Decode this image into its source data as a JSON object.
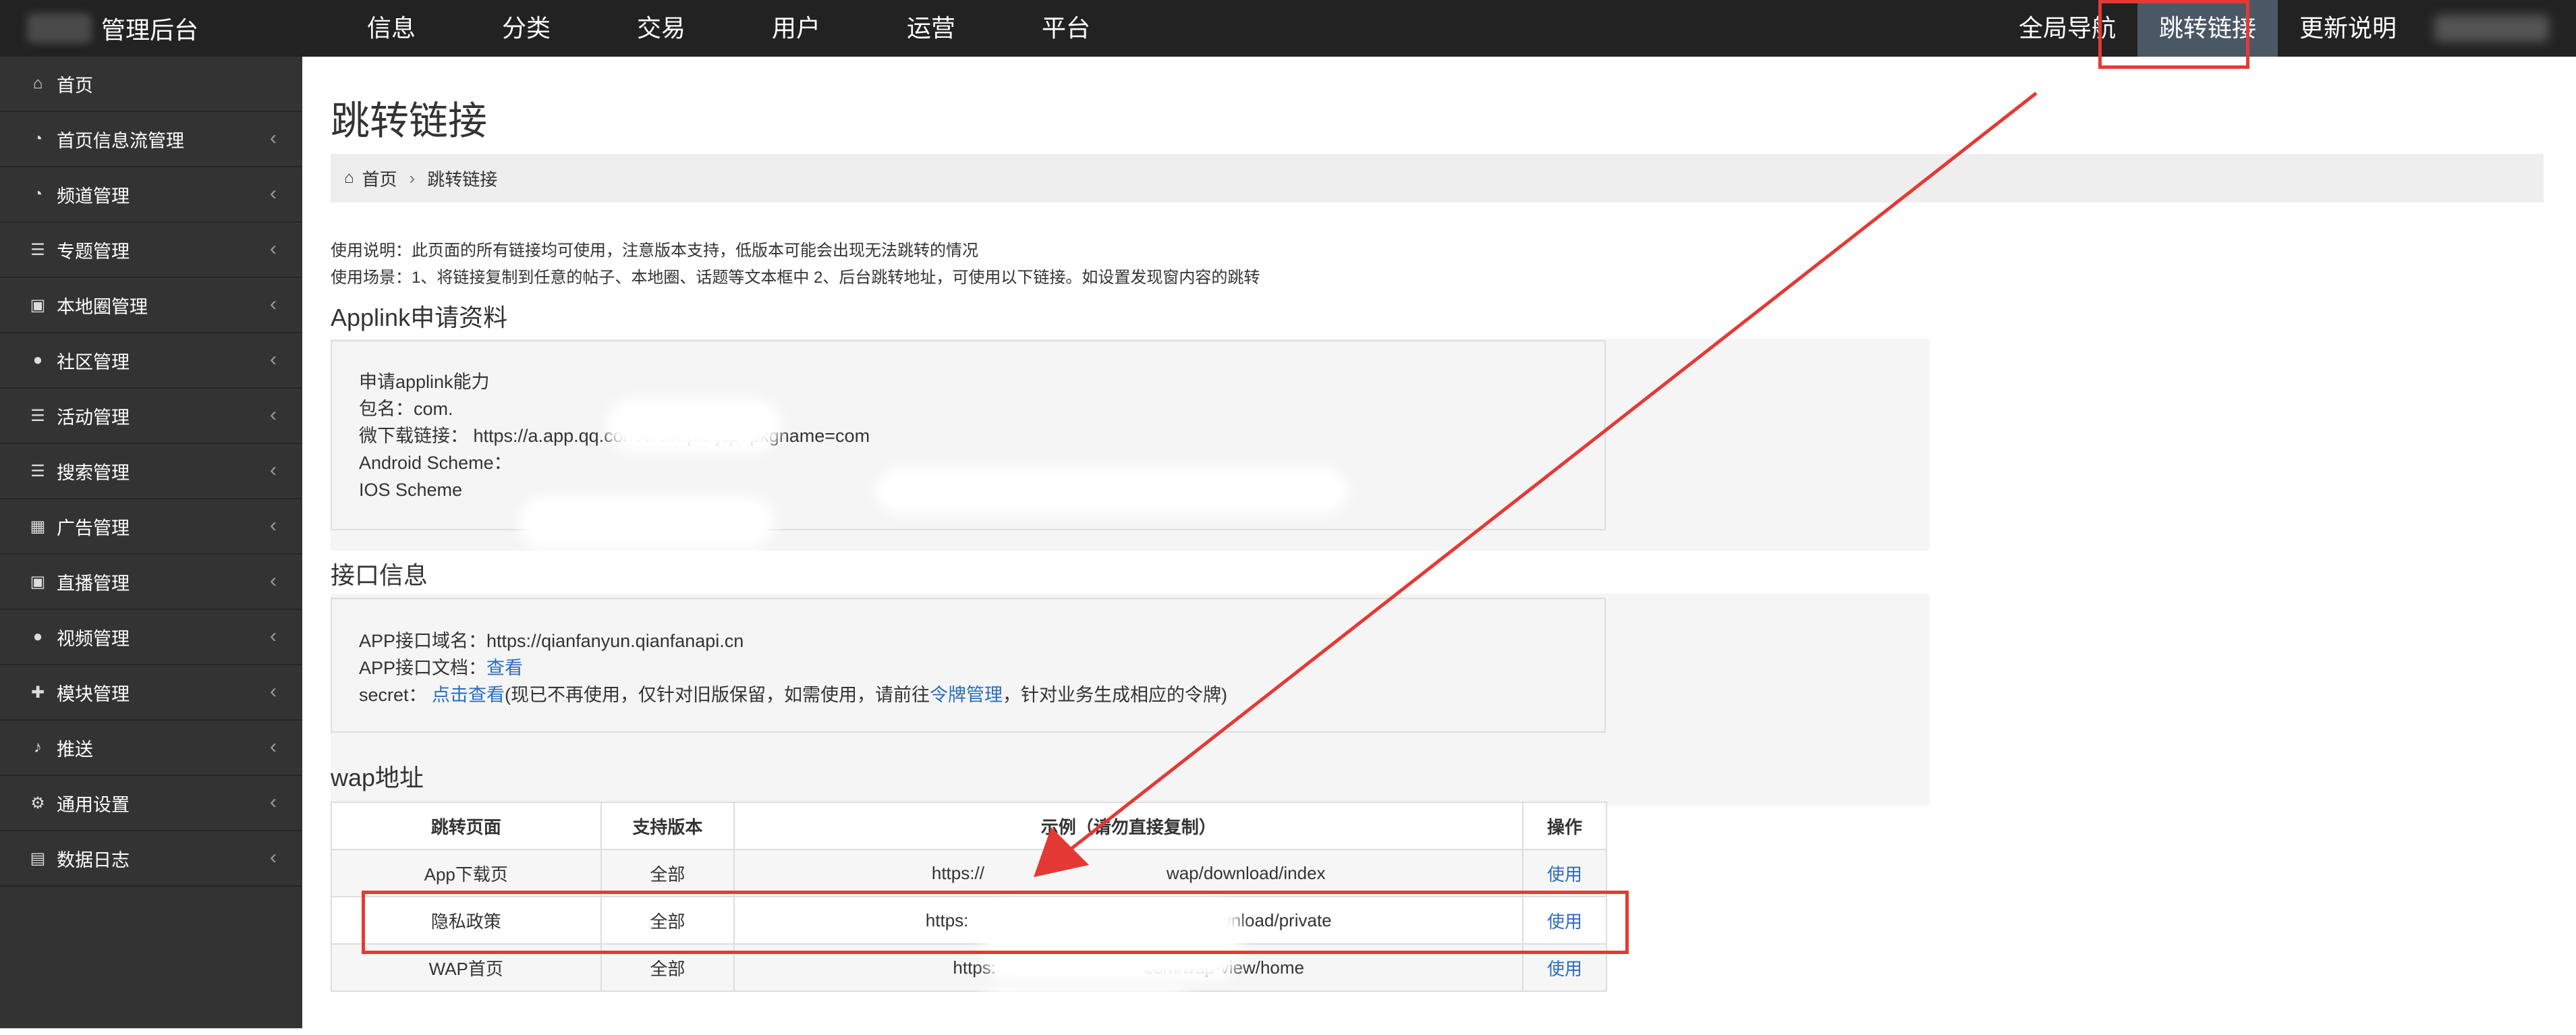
{
  "brand": {
    "title": "管理后台"
  },
  "top_nav": [
    "信息",
    "分类",
    "交易",
    "用户",
    "运营",
    "平台"
  ],
  "right_nav": [
    "全局导航",
    "跳转链接",
    "更新说明"
  ],
  "sidebar": {
    "items": [
      {
        "icon": "home-icon",
        "label": "首页"
      },
      {
        "icon": "rss-icon",
        "label": "首页信息流管理"
      },
      {
        "icon": "rss-icon",
        "label": "频道管理"
      },
      {
        "icon": "list-icon",
        "label": "专题管理"
      },
      {
        "icon": "camera-icon",
        "label": "本地圈管理"
      },
      {
        "icon": "users-icon",
        "label": "社区管理"
      },
      {
        "icon": "list-icon",
        "label": "活动管理"
      },
      {
        "icon": "list-icon",
        "label": "搜索管理"
      },
      {
        "icon": "calendar-icon",
        "label": "广告管理"
      },
      {
        "icon": "camera-icon",
        "label": "直播管理"
      },
      {
        "icon": "users-icon",
        "label": "视频管理"
      },
      {
        "icon": "puzzle-icon",
        "label": "模块管理"
      },
      {
        "icon": "bell-icon",
        "label": "推送"
      },
      {
        "icon": "gears-icon",
        "label": "通用设置"
      },
      {
        "icon": "chart-icon",
        "label": "数据日志"
      }
    ],
    "arrow": "‹"
  },
  "page": {
    "title": "跳转链接",
    "breadcrumb": {
      "home": "首页",
      "current": "跳转链接"
    },
    "desc_line1": "使用说明：此页面的所有链接均可使用，注意版本支持，低版本可能会出现无法跳转的情况",
    "desc_line2": "使用场景：1、将链接复制到任意的帖子、本地圈、话题等文本框中 2、后台跳转地址，可使用以下链接。如设置发现窗内容的跳转"
  },
  "applink": {
    "title": "Applink申请资料",
    "line1": "申请applink能力",
    "line2": "包名：com.",
    "line3": "微下载链接： https://a.app.qq.com/o/simple.jsp?pkgname=com",
    "line4": "Android Scheme：",
    "line5": "IOS Scheme"
  },
  "api": {
    "title": "接口信息",
    "domain": "APP接口域名：https://qianfanyun.qianfanapi.cn",
    "doc_label": "APP接口文档：",
    "doc_link": "查看",
    "secret_label": "secret：",
    "secret_link": "点击查看",
    "secret_mid": "(现已不再使用，仅针对旧版保留，如需使用，请前往",
    "token_link": "令牌管理",
    "secret_end": "，针对业务生成相应的令牌)"
  },
  "wap": {
    "title": "wap地址",
    "headers": [
      "跳转页面",
      "支持版本",
      "示例（请勿直接复制）",
      "操作"
    ],
    "rows": [
      {
        "page": "App下载页",
        "version": "全部",
        "url_left": "https://",
        "url_right": "wap/download/index",
        "action": "使用"
      },
      {
        "page": "隐私政策",
        "version": "全部",
        "url_left": "https:",
        "url_right": "p/download/private",
        "action": "使用"
      },
      {
        "page": "WAP首页",
        "version": "全部",
        "url_left": "https:",
        "url_right": "com/wap-view/home",
        "action": "使用"
      }
    ]
  },
  "colors": {
    "topbar": "#222222",
    "sidebar": "#333333",
    "active_nav": "#4a5866",
    "annotation": "#e53935",
    "link": "#2a6dbd"
  }
}
